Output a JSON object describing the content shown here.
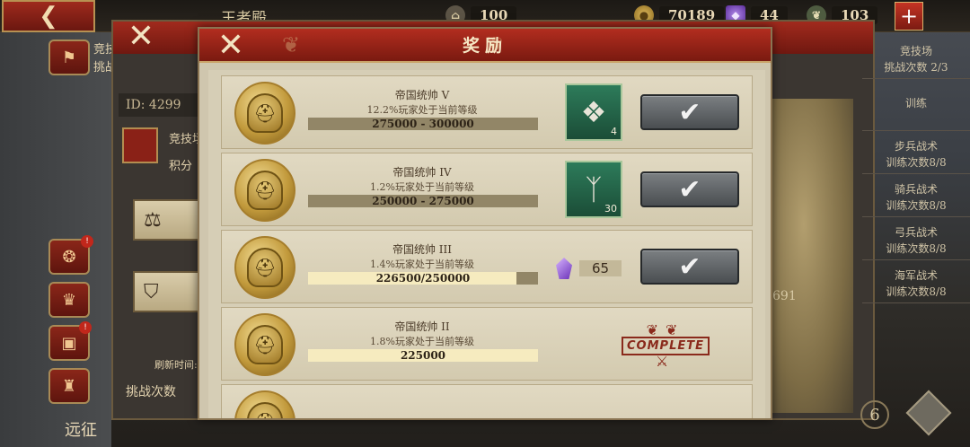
{
  "topbar": {
    "back_icon": "back-arrow-icon",
    "title": "王者殿",
    "resources": [
      {
        "icon": "temple-icon",
        "value": "100"
      },
      {
        "icon": "gold-coin-icon",
        "value": "70189"
      },
      {
        "icon": "gem-icon",
        "value": "44"
      },
      {
        "icon": "laurel-icon",
        "value": "103"
      }
    ],
    "plus_label": "+"
  },
  "background": {
    "left_tabs": [
      {
        "label": "竞技场",
        "sub": "挑战"
      },
      {
        "label": "",
        "badge": "!"
      },
      {
        "label": ""
      },
      {
        "label": "",
        "badge": "!"
      },
      {
        "label": ""
      }
    ],
    "expedition_label": "远征",
    "id_label": "ID: 4299",
    "arena_label": "竞技场",
    "score_label": "积分",
    "refresh_label": "刷新时间:",
    "challenge_count_label": "挑战次数",
    "right_items": [
      {
        "title": "竞技场",
        "sub": "挑战次数 2/3"
      },
      {
        "title": "训练",
        "sub": ""
      },
      {
        "title": "步兵战术",
        "sub": "训练次数8/8"
      },
      {
        "title": "骑兵战术",
        "sub": "训练次数8/8"
      },
      {
        "title": "弓兵战术",
        "sub": "训练次数8/8"
      },
      {
        "title": "海军战术",
        "sub": "训练次数8/8"
      }
    ],
    "map_number": "691",
    "bottom_number": "6"
  },
  "modal": {
    "title": "奖励",
    "close_label": "✕",
    "claim_icon": "checkmark-icon",
    "rows": [
      {
        "rank": "帝国统帅 V",
        "percent": "12.2%玩家处于当前等级",
        "range": "275000 - 300000",
        "progress": 0,
        "reward_type": "item",
        "reward_icon": "crystal-icon",
        "reward_count": "4",
        "state": "claim"
      },
      {
        "rank": "帝国统帅 IV",
        "percent": "1.2%玩家处于当前等级",
        "range": "250000 - 275000",
        "progress": 0,
        "reward_type": "item",
        "reward_icon": "rune-stone-icon",
        "reward_count": "30",
        "state": "claim"
      },
      {
        "rank": "帝国统帅 III",
        "percent": "1.4%玩家处于当前等级",
        "range": "226500/250000",
        "progress": 0.906,
        "reward_type": "gem",
        "reward_icon": "gem-icon",
        "reward_count": "65",
        "state": "claim"
      },
      {
        "rank": "帝国统帅 II",
        "percent": "1.8%玩家处于当前等级",
        "range": "225000",
        "progress": 1,
        "reward_type": "none",
        "state": "complete",
        "complete_label": "COMPLETE"
      }
    ]
  },
  "colors": {
    "header_red": "#b22d1f",
    "panel_parchment": "#cfc6ae",
    "progress_fill": "#f6ebbf",
    "claim_button": "#5f6366",
    "stamp_red": "#8a2a1c"
  }
}
